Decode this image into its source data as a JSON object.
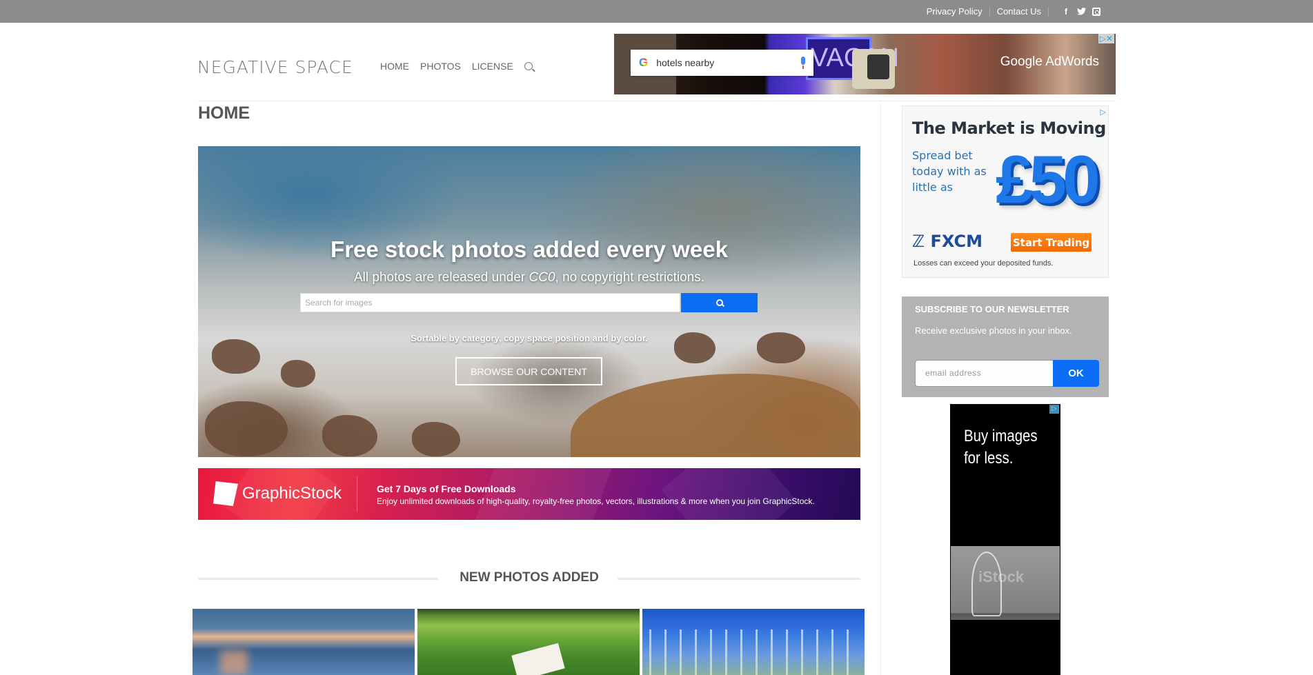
{
  "topbar": {
    "links": [
      {
        "label": "Privacy Policy"
      },
      {
        "label": "Contact Us"
      }
    ],
    "social": [
      "facebook-icon",
      "twitter-icon",
      "instagram-icon"
    ],
    "facebook_glyph": "f",
    "twitter_glyph": "•"
  },
  "header": {
    "logo": "NEGATIVE SPACE",
    "nav": [
      {
        "label": "HOME"
      },
      {
        "label": "PHOTOS"
      },
      {
        "label": "LICENSE"
      }
    ],
    "search_icon": "search-icon"
  },
  "ad_top": {
    "search_query": "hotels nearby",
    "google_letter": "G",
    "neon_text": "VACAN",
    "brand": "Google AdWords",
    "adchoices": "▷✕"
  },
  "page": {
    "title": "HOME"
  },
  "hero": {
    "headline": "Free stock photos added every week",
    "sub_before": "All photos are released under ",
    "sub_em": "CC0",
    "sub_after": ", no copyright restrictions.",
    "search_placeholder": "Search for images",
    "note": "Sortable by category, copy space position and by color.",
    "browse_label": "BROWSE OUR CONTENT"
  },
  "graphicstock": {
    "brand": "GraphicStock",
    "title": "Get 7 Days of Free Downloads",
    "text": "Enjoy unlimited downloads of high-quality, royalty-free photos, vectors, illustrations & more when you join GraphicStock."
  },
  "new_photos": {
    "heading": "NEW PHOTOS ADDED",
    "thumbs": [
      "sunset-over-lake",
      "notebook-on-grass",
      "grass-against-blue-sky"
    ]
  },
  "sidebar": {
    "fxcm_ad": {
      "title": "The Market is Moving",
      "sub_lines": [
        "Spread bet",
        "today with as",
        "little as"
      ],
      "amount": "£50",
      "logo": "ℤ FXCM",
      "button": "Start Trading",
      "note": "Losses can exceed your deposited funds.",
      "adchoices": "▷"
    },
    "newsletter": {
      "title": "SUBSCRIBE TO OUR NEWSLETTER",
      "text": "Receive exclusive photos in your inbox.",
      "email_placeholder": "email address",
      "button": "OK"
    },
    "istock_ad": {
      "text_line1": "Buy images",
      "text_line2": "for less.",
      "adchoices": "▷"
    }
  },
  "colors": {
    "topbar": "#8c8c8c",
    "accent_blue": "#0b6cf5",
    "newsletter_bg": "#b3b3b3",
    "fxcm_orange": "#f57a0a",
    "title_gray": "#555555"
  }
}
